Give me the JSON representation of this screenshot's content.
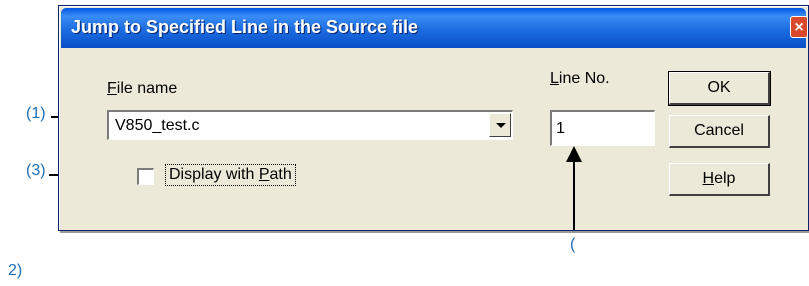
{
  "dialog": {
    "title": "Jump to Specified Line in the Source file",
    "close_glyph": "×",
    "file_name_label_accel": "F",
    "file_name_label_rest": "ile name",
    "file_name_value": "V850_test.c",
    "line_no_label_accel": "L",
    "line_no_label_rest": "ine No.",
    "line_no_value": "1",
    "display_path_label_pre": "Display with ",
    "display_path_label_accel": "P",
    "display_path_label_rest": "ath",
    "display_path_checked": false,
    "ok_label": "OK",
    "cancel_label": "Cancel",
    "help_label_accel": "H",
    "help_label_rest": "elp"
  },
  "annotations": {
    "label_1": "(1)",
    "label_3": "(3)",
    "label_2a": "(",
    "label_2b": "2)"
  },
  "colors": {
    "titlebar": "#0a58d8",
    "dialog_bg": "#ece9d8",
    "annotation": "#1d6fb8"
  },
  "icons": {
    "close": "close-icon",
    "dropdown": "chevron-down-icon"
  }
}
